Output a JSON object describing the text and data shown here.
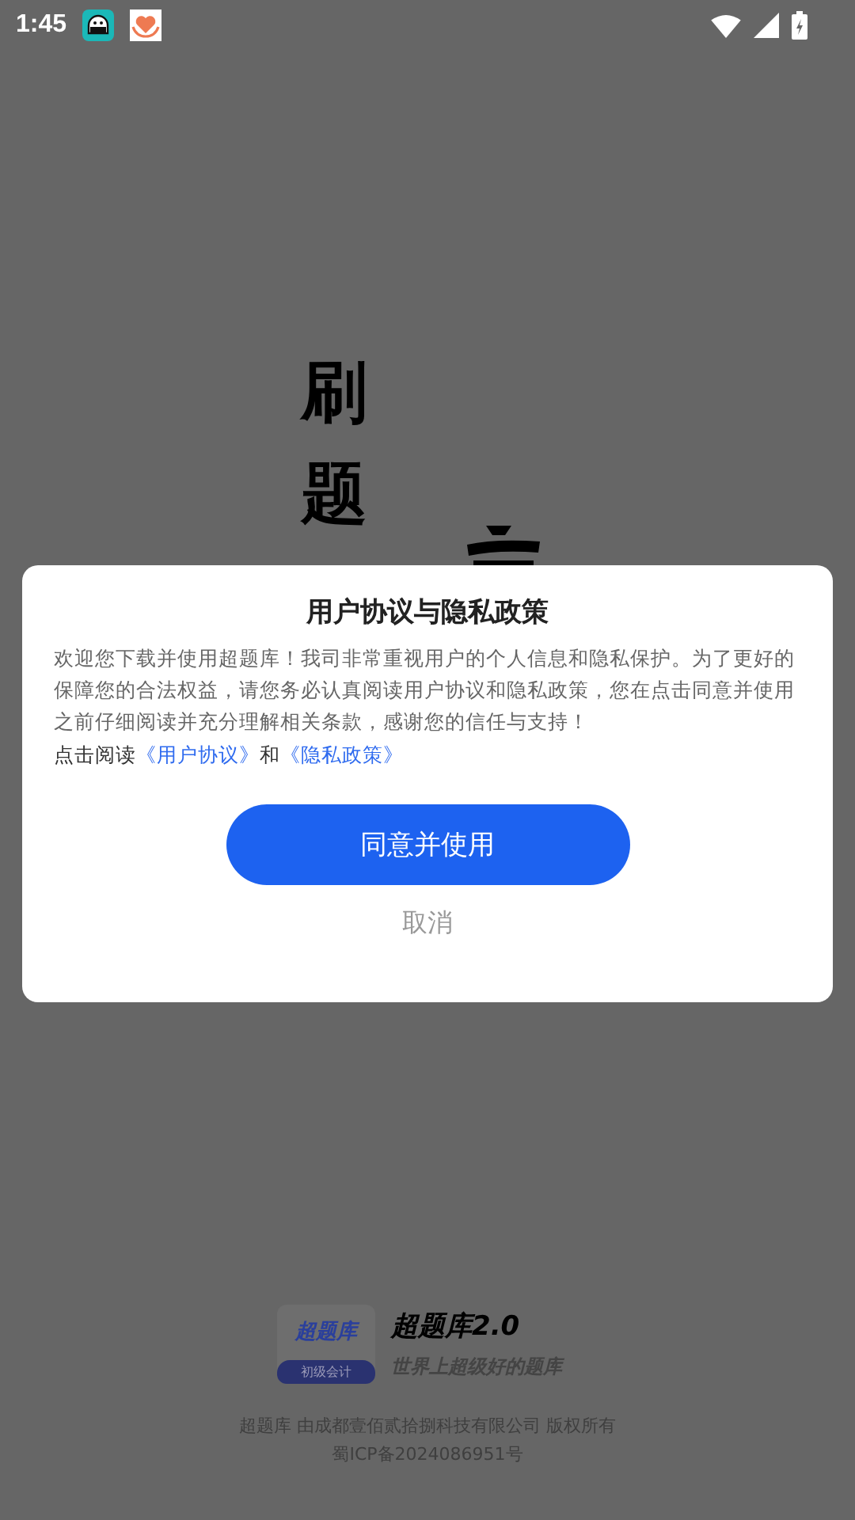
{
  "status_bar": {
    "time": "1:45"
  },
  "background": {
    "title_chars": [
      "刷",
      "题"
    ],
    "logo": {
      "badge_title": "超题库",
      "badge_label": "初级会计"
    },
    "app_name": "超题库2.0",
    "slogan": "世界上超级好的题库",
    "copyright": "超题库 由成都壹佰贰拾捌科技有限公司 版权所有",
    "icp": "蜀ICP备2024086951号"
  },
  "dialog": {
    "title": "用户协议与隐私政策",
    "body": "欢迎您下载并使用超题库！我司非常重视用户的个人信息和隐私保护。为了更好的保障您的合法权益，请您务必认真阅读用户协议和隐私政策，您在点击同意并使用之前仔细阅读并充分理解相关条款，感谢您的信任与支持！",
    "links_prefix": "点击阅读",
    "links": [
      "《用户协议》",
      "《隐私政策》"
    ],
    "links_joiner": "和",
    "confirm": "同意并使用",
    "cancel": "取消"
  }
}
